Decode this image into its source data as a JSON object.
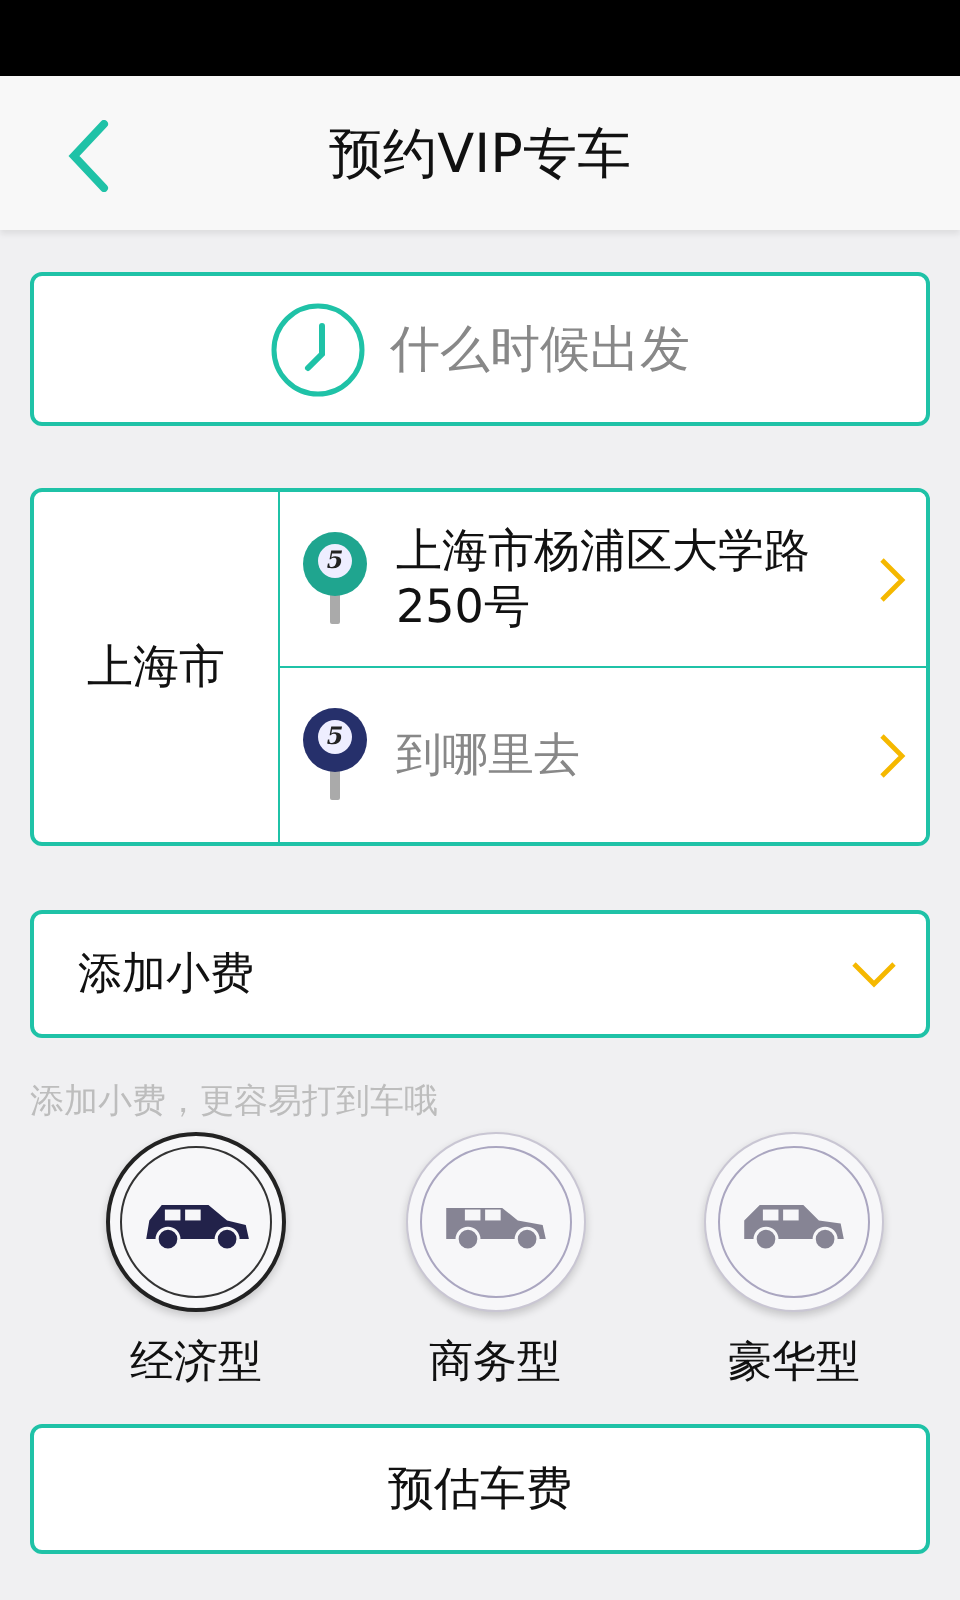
{
  "header": {
    "title": "预约VIP专车"
  },
  "departure_time": {
    "placeholder": "什么时候出发"
  },
  "route": {
    "city": "上海市",
    "stops": [
      {
        "pin_label": "5",
        "color": "#1fa58f",
        "value": "上海市杨浦区大学路250号"
      },
      {
        "pin_label": "5",
        "color": "#26306b",
        "placeholder": "到哪里去"
      }
    ]
  },
  "tip": {
    "label": "添加小费",
    "hint": "添加小费，更容易打到车哦"
  },
  "vehicles": [
    {
      "kind": "minivan",
      "label": "经济型",
      "selected": true
    },
    {
      "kind": "wagon",
      "label": "商务型",
      "selected": false
    },
    {
      "kind": "suv",
      "label": "豪华型",
      "selected": false
    }
  ],
  "estimate_button": "预估车费"
}
